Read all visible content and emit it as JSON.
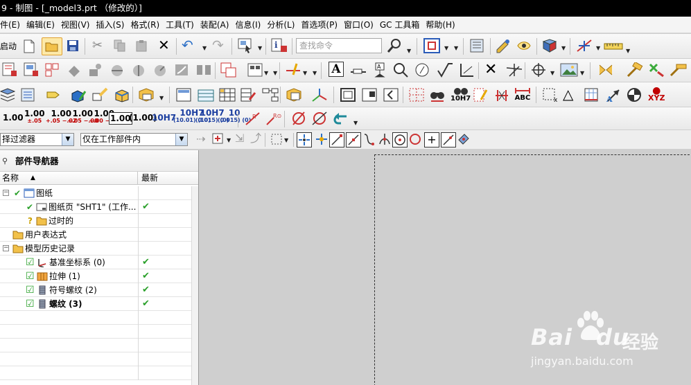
{
  "window": {
    "title": "9 - 制图 - [_model3.prt （修改的）]"
  },
  "menu": [
    "件(E)",
    "编辑(E)",
    "视图(V)",
    "插入(S)",
    "格式(R)",
    "工具(T)",
    "装配(A)",
    "信息(I)",
    "分析(L)",
    "首选项(P)",
    "窗口(O)",
    "GC 工具箱",
    "帮助(H)"
  ],
  "toolbar": {
    "start_label": "启动",
    "search_placeholder": "查找命令",
    "dimension_styles": [
      {
        "main": "1.00",
        "sub": ""
      },
      {
        "main": "1.00",
        "sub": "±.05"
      },
      {
        "main": "1.00",
        "sub": "+.05 −.02"
      },
      {
        "main": "1.00",
        "sub": "+.05 −.00"
      },
      {
        "main": "1.00",
        "sub": "+.00 −.02"
      },
      {
        "main": "1.00",
        "sub": ""
      },
      {
        "main": "(1.00)",
        "sub": ""
      },
      {
        "main": "10H7",
        "sub": ""
      },
      {
        "main": "10H7",
        "sub": "(10.01) (10)"
      },
      {
        "main": "10H7",
        "sub": "(0.015) (0)"
      },
      {
        "main": "10",
        "sub": "(0.015) (0)"
      }
    ],
    "abc_label": "ABC",
    "xyz_label": "XYZ",
    "fit_label": "10H7"
  },
  "filter_bar": {
    "selection_filter": "择过滤器",
    "scope": "仅在工作部件内"
  },
  "navigator": {
    "title": "部件导航器",
    "columns": {
      "name": "名称",
      "latest": "最新"
    },
    "rows": [
      {
        "label": "图纸",
        "indent": 0,
        "expander": "−",
        "check": "✔",
        "latest": ""
      },
      {
        "label": "图纸页 \"SHT1\" (工作...",
        "indent": 1,
        "expander": "",
        "check": "✔",
        "latest": "✔"
      },
      {
        "label": "过时的",
        "indent": 1,
        "expander": "",
        "check": "?",
        "latest": ""
      },
      {
        "label": "用户表达式",
        "indent": 0,
        "expander": "",
        "check": "",
        "latest": ""
      },
      {
        "label": "模型历史记录",
        "indent": 0,
        "expander": "−",
        "check": "",
        "latest": ""
      },
      {
        "label": "基准坐标系 (0)",
        "indent": 1,
        "expander": "",
        "check": "☑",
        "latest": "✔"
      },
      {
        "label": "拉伸 (1)",
        "indent": 1,
        "expander": "",
        "check": "☑",
        "latest": "✔"
      },
      {
        "label": "符号螺纹 (2)",
        "indent": 1,
        "expander": "",
        "check": "☑",
        "latest": "✔"
      },
      {
        "label": "螺纹 (3)",
        "indent": 1,
        "expander": "",
        "check": "☑",
        "latest": "✔"
      }
    ]
  },
  "watermark": {
    "brand": "Bai",
    "brand2": "du",
    "cn": "经验",
    "url": "jingyan.baidu.com"
  },
  "colors": {
    "titlebar": "#000000",
    "check_green": "#2aa02a",
    "tolerance_red": "#c00000",
    "canvas": "#cfcfcf"
  }
}
